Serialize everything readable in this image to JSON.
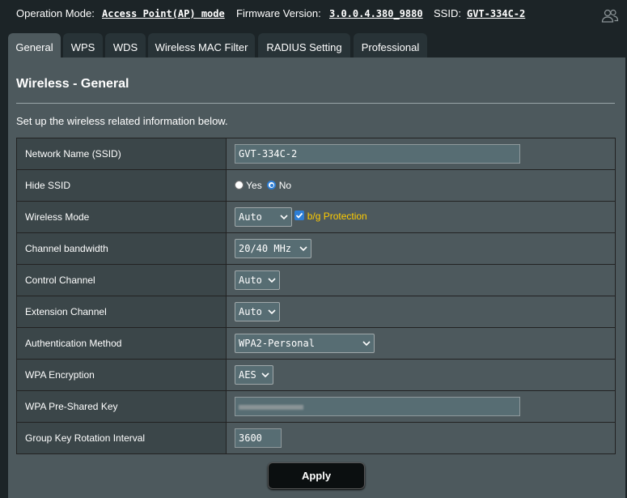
{
  "header": {
    "op_mode_label": "Operation Mode:",
    "op_mode_value": "Access Point(AP) mode",
    "firmware_label": "Firmware Version:",
    "firmware_value": "3.0.0.4.380_9880",
    "ssid_label": "SSID:",
    "ssid_value": "GVT-334C-2",
    "user_icon": "users-icon"
  },
  "tabs": [
    {
      "label": "General",
      "active": true
    },
    {
      "label": "WPS"
    },
    {
      "label": "WDS"
    },
    {
      "label": "Wireless MAC Filter"
    },
    {
      "label": "RADIUS Setting"
    },
    {
      "label": "Professional"
    }
  ],
  "panel": {
    "title": "Wireless - General",
    "description": "Set up the wireless related information below."
  },
  "settings": {
    "ssid": {
      "label": "Network Name (SSID)",
      "value": "GVT-334C-2"
    },
    "hide_ssid": {
      "label": "Hide SSID",
      "options": [
        "Yes",
        "No"
      ],
      "selected": "No"
    },
    "wireless_mode": {
      "label": "Wireless Mode",
      "value": "Auto",
      "bg_protection_label": "b/g Protection",
      "bg_protection_checked": true
    },
    "channel_bandwidth": {
      "label": "Channel bandwidth",
      "value": "20/40 MHz"
    },
    "control_channel": {
      "label": "Control Channel",
      "value": "Auto"
    },
    "extension_channel": {
      "label": "Extension Channel",
      "value": "Auto"
    },
    "auth_method": {
      "label": "Authentication Method",
      "value": "WPA2-Personal"
    },
    "wpa_encryption": {
      "label": "WPA Encryption",
      "value": "AES"
    },
    "wpa_psk": {
      "label": "WPA Pre-Shared Key"
    },
    "group_key": {
      "label": "Group Key Rotation Interval",
      "value": "3600"
    }
  },
  "apply_label": "Apply",
  "colors": {
    "background": "#1c2427",
    "panel": "#4d595d",
    "label_cell": "#3b4649",
    "accent_yellow": "#ffcc00",
    "accent_blue": "#2d7ed6"
  }
}
